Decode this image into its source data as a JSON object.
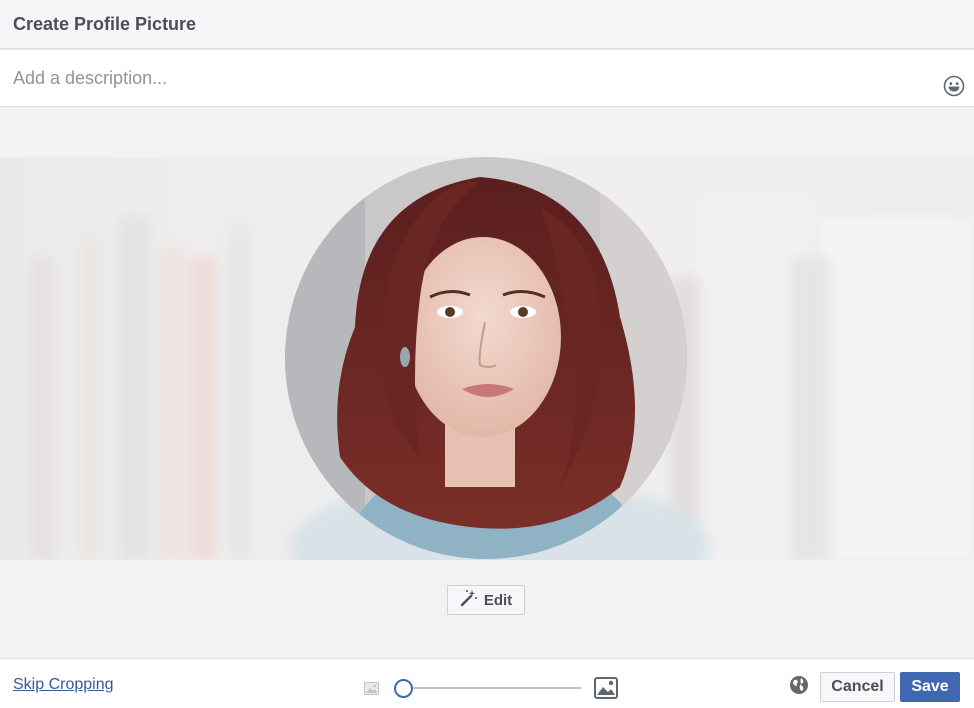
{
  "header": {
    "title": "Create Profile Picture"
  },
  "description": {
    "placeholder": "Add a description...",
    "value": "",
    "emoji_icon": "emoji-icon"
  },
  "photo": {
    "subject": "profile-photo"
  },
  "edit": {
    "label": "Edit",
    "icon": "magic-wand-icon"
  },
  "footer": {
    "skip_label": "Skip Cropping",
    "zoom": {
      "value": 0,
      "min_icon": "image-small-icon",
      "max_icon": "image-large-icon"
    },
    "privacy_icon": "globe-icon",
    "cancel_label": "Cancel",
    "save_label": "Save"
  },
  "colors": {
    "accent": "#4267b2",
    "link": "#365899",
    "header_bg": "#f5f6f7"
  }
}
